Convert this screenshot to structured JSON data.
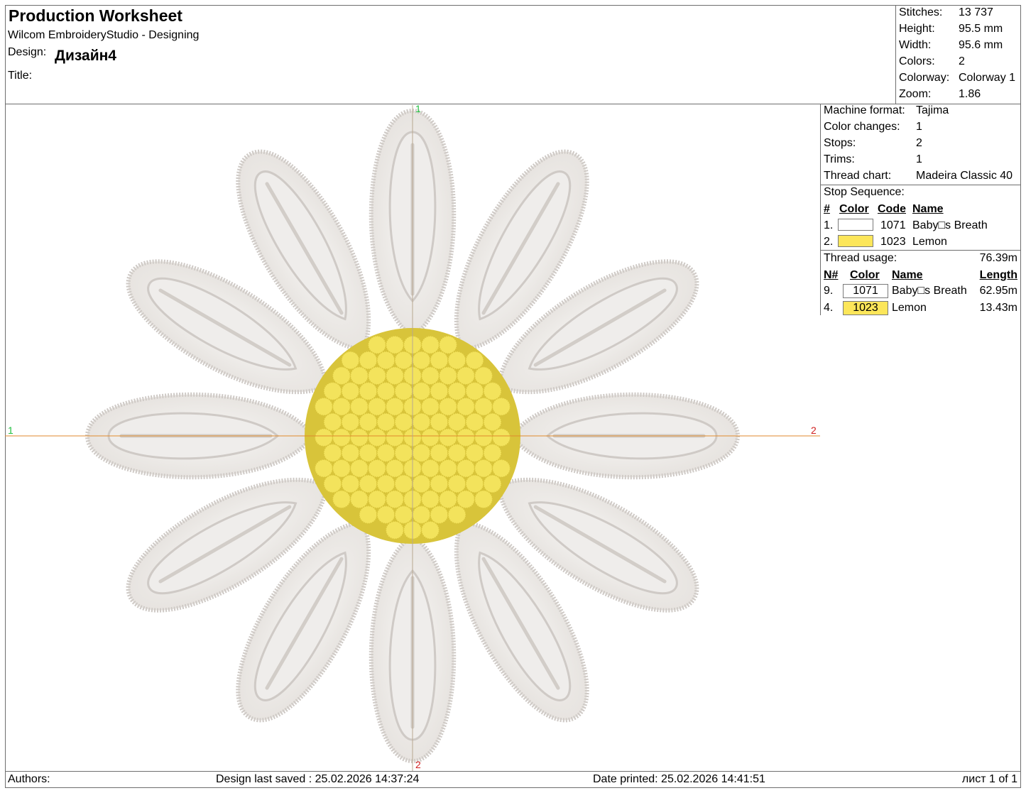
{
  "header": {
    "title": "Production Worksheet",
    "app": "Wilcom EmbroideryStudio - Designing",
    "design_label": "Design:",
    "design_name": "Дизайн4",
    "title_label": "Title:"
  },
  "stats": [
    {
      "label": "Stitches:",
      "value": "13 737"
    },
    {
      "label": "Height:",
      "value": "95.5 mm"
    },
    {
      "label": "Width:",
      "value": "95.6 mm"
    },
    {
      "label": "Colors:",
      "value": "2"
    },
    {
      "label": "Colorway:",
      "value": "Colorway 1"
    },
    {
      "label": "Zoom:",
      "value": "1.86"
    }
  ],
  "machine": [
    {
      "label": "Machine format:",
      "value": "Tajima"
    },
    {
      "label": "Color changes:",
      "value": "1"
    },
    {
      "label": "Stops:",
      "value": "2"
    },
    {
      "label": "Trims:",
      "value": "1"
    },
    {
      "label": "Thread chart:",
      "value": "Madeira Classic 40"
    }
  ],
  "stop_sequence": {
    "title": "Stop Sequence:",
    "headers": [
      "#",
      "Color",
      "Code",
      "Name"
    ],
    "rows": [
      {
        "num": "1.",
        "color": "#ffffff",
        "code": "1071",
        "name": "Baby□s Breath"
      },
      {
        "num": "2.",
        "color": "#fce65a",
        "code": "1023",
        "name": "Lemon"
      }
    ]
  },
  "thread_usage": {
    "title": "Thread usage:",
    "total": "76.39m",
    "headers": [
      "N#",
      "Color",
      "Name",
      "Length"
    ],
    "rows": [
      {
        "num": "9.",
        "color": "#ffffff",
        "code": "1071",
        "name": "Baby□s Breath",
        "length": "62.95m"
      },
      {
        "num": "4.",
        "color": "#fce65a",
        "code": "1023",
        "name": "Lemon",
        "length": "13.43m"
      }
    ]
  },
  "axes": {
    "top": "1",
    "bottom": "2",
    "left": "1",
    "right": "2"
  },
  "footer": {
    "authors": "Authors:",
    "saved": "Design last saved : 25.02.2026 14:37:24",
    "printed": "Date printed: 25.02.2026 14:41:51",
    "sheet": "лист 1 of 1"
  },
  "colors": {
    "petal": "#efedeb",
    "petal_shade": "#cfcac6",
    "center": "#f3e35c",
    "center_shade": "#d8c43a",
    "axis_h": "#e08a2c",
    "axis_v": "#b0a090"
  }
}
